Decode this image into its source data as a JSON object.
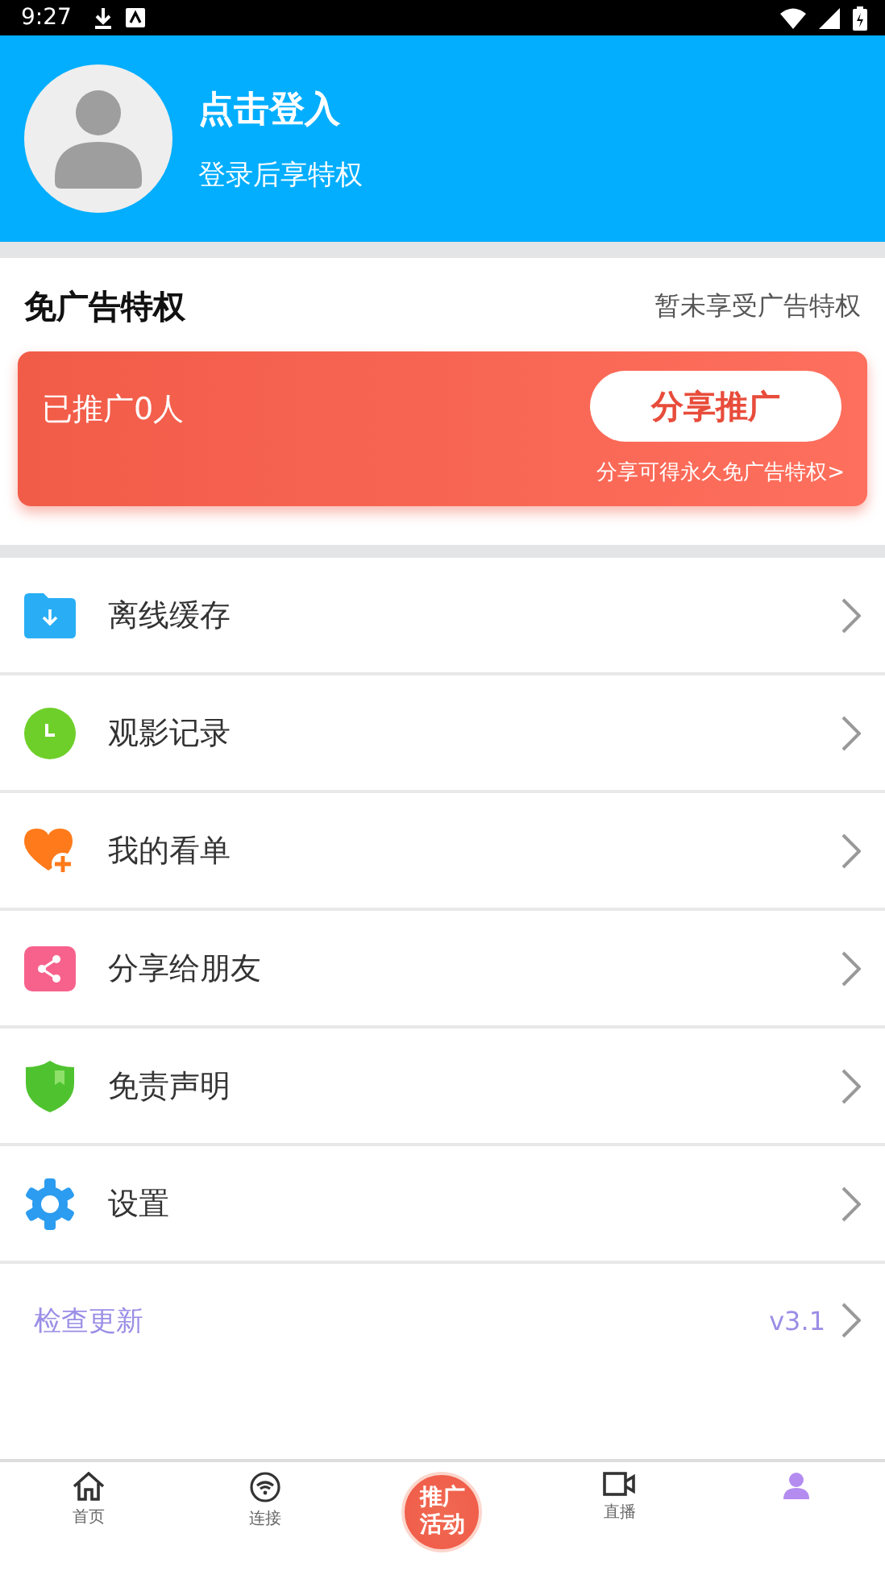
{
  "status_bar": {
    "time": "9:27"
  },
  "profile": {
    "title": "点击登入",
    "subtitle": "登录后享特权"
  },
  "ad_free": {
    "title": "免广告特权",
    "status": "暂未享受广告特权",
    "promoted": "已推广0人",
    "button": "分享推广",
    "note": "分享可得永久免广告特权>"
  },
  "menu": [
    {
      "kind": "download",
      "label": "离线缓存"
    },
    {
      "kind": "history",
      "label": "观影记录"
    },
    {
      "kind": "watchlist",
      "label": "我的看单"
    },
    {
      "kind": "share",
      "label": "分享给朋友"
    },
    {
      "kind": "disclaimer",
      "label": "免责声明"
    },
    {
      "kind": "settings",
      "label": "设置"
    }
  ],
  "update": {
    "label": "检查更新",
    "version": "v3.1"
  },
  "bottom_nav": [
    {
      "kind": "home",
      "label": "首页",
      "selected": false
    },
    {
      "kind": "connect",
      "label": "连接",
      "selected": false
    },
    {
      "kind": "promo",
      "label": "推广活动",
      "selected": false
    },
    {
      "kind": "live",
      "label": "直播",
      "selected": false
    },
    {
      "kind": "profile",
      "selected": true
    }
  ]
}
